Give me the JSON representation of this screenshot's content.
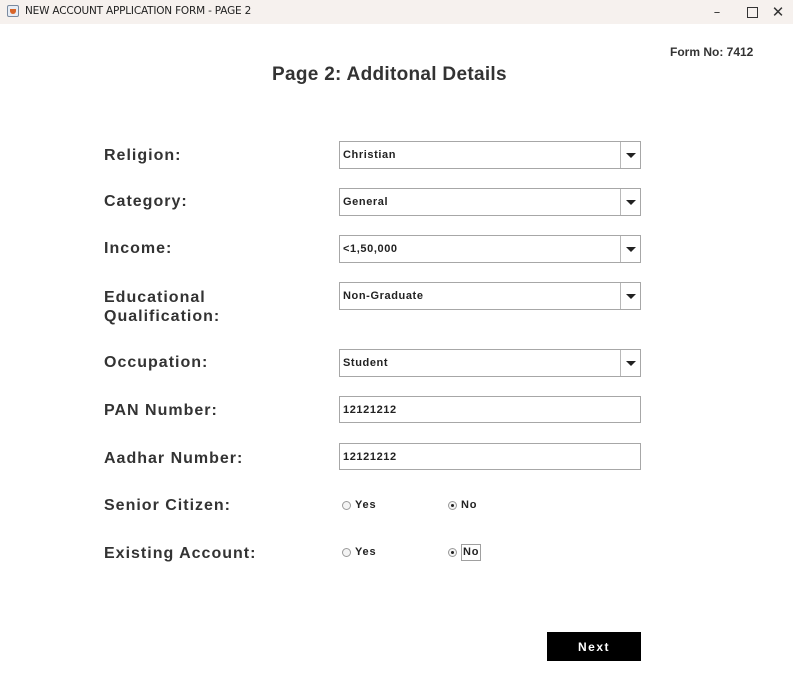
{
  "window": {
    "title": "NEW ACCOUNT APPLICATION FORM - PAGE 2",
    "minimize": "–",
    "close": "✕"
  },
  "form_no": "Form No: 7412",
  "heading": "Page 2: Additonal Details",
  "fields": {
    "religion": {
      "label": "Religion:",
      "value": "Christian"
    },
    "category": {
      "label": "Category:",
      "value": "General"
    },
    "income": {
      "label": "Income:",
      "value": "<1,50,000"
    },
    "education": {
      "label_line1": "Educational",
      "label_line2": "Qualification:",
      "value": "Non-Graduate"
    },
    "occupation": {
      "label": "Occupation:",
      "value": "Student"
    },
    "pan": {
      "label": "PAN Number:",
      "value": "12121212"
    },
    "aadhar": {
      "label": "Aadhar Number:",
      "value": "12121212"
    },
    "senior_citizen": {
      "label": "Senior Citizen:",
      "yes": "Yes",
      "no": "No",
      "selected": "No"
    },
    "existing_account": {
      "label": "Existing Account:",
      "yes": "Yes",
      "no": "No",
      "selected": "No"
    }
  },
  "next_button": "Next",
  "icons": {
    "app": "java-app-icon",
    "dropdown": "chevron-down-icon"
  }
}
